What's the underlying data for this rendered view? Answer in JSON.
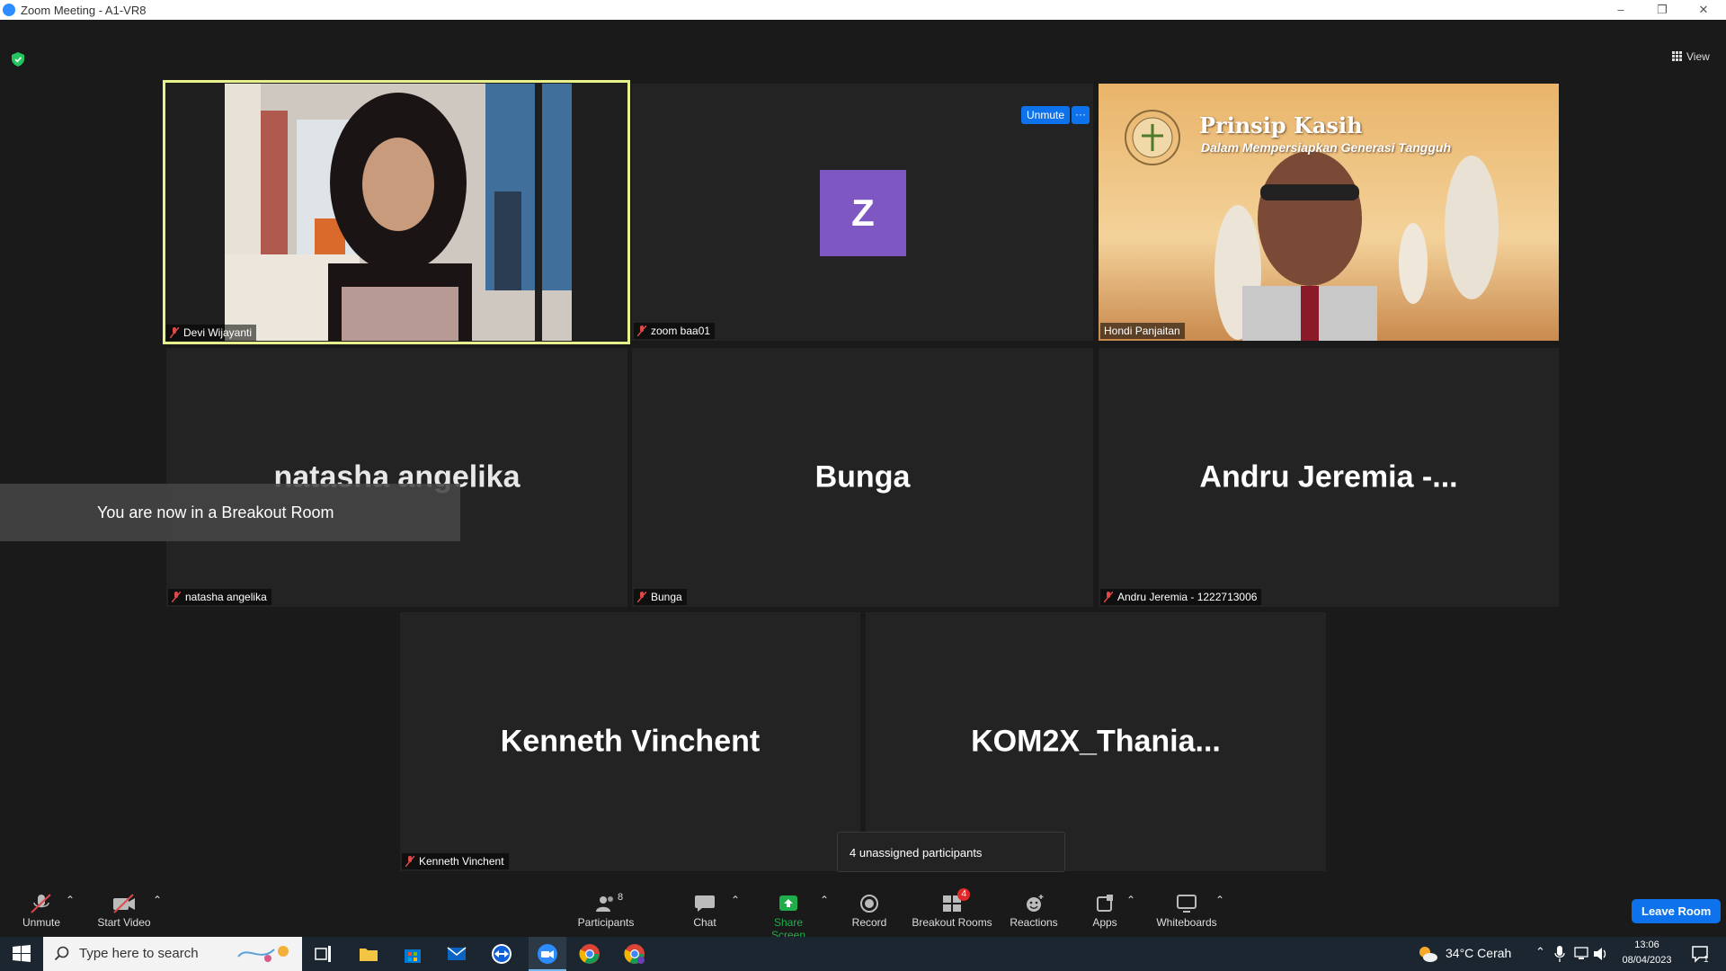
{
  "window": {
    "title": "Zoom Meeting - A1-VR8"
  },
  "top": {
    "view_label": "View"
  },
  "tiles": [
    {
      "name_label": "Devi Wijayanti"
    },
    {
      "name_label": "zoom baa01",
      "avatar_letter": "Z",
      "unmute_label": "Unmute",
      "more_label": "···"
    },
    {
      "name_label": "Hondi Panjaitan",
      "banner_title": "Prinsip Kasih",
      "banner_subtitle": "Dalam Mempersiapkan Generasi Tangguh"
    },
    {
      "big_name": "natasha angelika",
      "name_label": "natasha angelika"
    },
    {
      "big_name": "Bunga",
      "name_label": "Bunga"
    },
    {
      "big_name": "Andru Jeremia -...",
      "name_label": "Andru Jeremia - 1222713006"
    },
    {
      "big_name": "Kenneth Vinchent",
      "name_label": "Kenneth Vinchent"
    },
    {
      "big_name": "KOM2X_Thania..."
    }
  ],
  "notice": "You are now in a Breakout Room",
  "tooltip": "4 unassigned participants",
  "toolbar": {
    "unmute": "Unmute",
    "start_video": "Start Video",
    "participants": "Participants",
    "participants_count": "8",
    "chat": "Chat",
    "share_screen": "Share Screen",
    "record": "Record",
    "breakout_rooms": "Breakout Rooms",
    "breakout_badge": "4",
    "reactions": "Reactions",
    "apps": "Apps",
    "whiteboards": "Whiteboards",
    "leave_room": "Leave Room"
  },
  "taskbar": {
    "search_placeholder": "Type here to search",
    "weather": "34°C  Cerah",
    "time": "13:06",
    "date": "08/04/2023",
    "notification_count": "1"
  },
  "colors": {
    "accent": "#0e72ed",
    "active_border": "#e9f18c",
    "avatar": "#7e57c2",
    "share_green": "#1fae4b",
    "badge_red": "#e02828"
  }
}
